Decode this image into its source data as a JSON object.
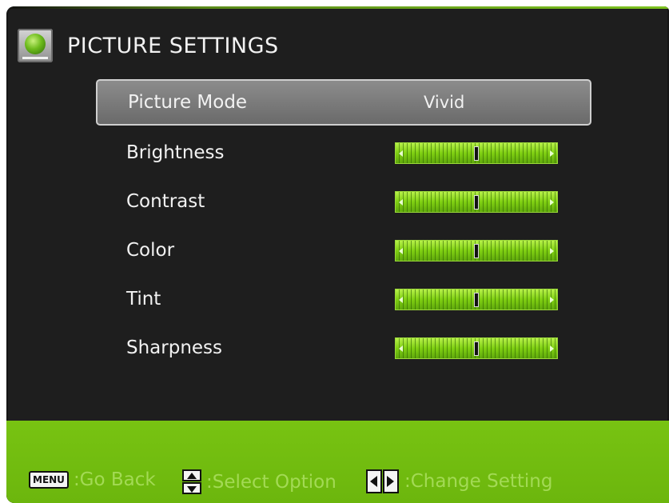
{
  "header": {
    "title": "PICTURE SETTINGS",
    "icon": "tv-picture-icon"
  },
  "menu": {
    "picture_mode": {
      "label": "Picture Mode",
      "value": "Vivid"
    },
    "brightness": {
      "label": "Brightness",
      "level": 0.5
    },
    "contrast": {
      "label": "Contrast",
      "level": 0.5
    },
    "color": {
      "label": "Color",
      "level": 0.5
    },
    "tint": {
      "label": "Tint",
      "level": 0.5
    },
    "sharpness": {
      "label": "Sharpness",
      "level": 0.5
    }
  },
  "footer": {
    "menu_key": "MENU",
    "go_back": ":Go Back",
    "select_option": ":Select Option",
    "change_setting": ":Change Setting"
  },
  "colors": {
    "accent_green": "#6fb90f",
    "panel_bg": "#1e1e1e",
    "selected_row": "#7b7b7b",
    "footer_text": "#a3da55"
  }
}
